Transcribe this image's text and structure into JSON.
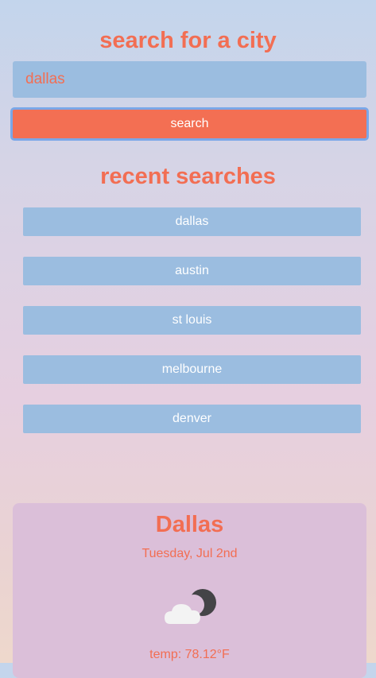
{
  "search": {
    "title": "search for a city",
    "input_value": "dallas",
    "button_label": "search"
  },
  "recent": {
    "title": "recent searches",
    "items": [
      {
        "label": "dallas"
      },
      {
        "label": "austin"
      },
      {
        "label": "st louis"
      },
      {
        "label": "melbourne"
      },
      {
        "label": "denver"
      }
    ]
  },
  "weather": {
    "city": "Dallas",
    "date": "Tuesday, Jul 2nd",
    "icon": "partly-cloudy-night-icon",
    "temp": "temp: 78.12°F"
  },
  "colors": {
    "accent": "#f26e53",
    "panel_blue": "#9bbde0",
    "card": "#dbbfd9",
    "focus_ring": "#7aa7e8"
  }
}
